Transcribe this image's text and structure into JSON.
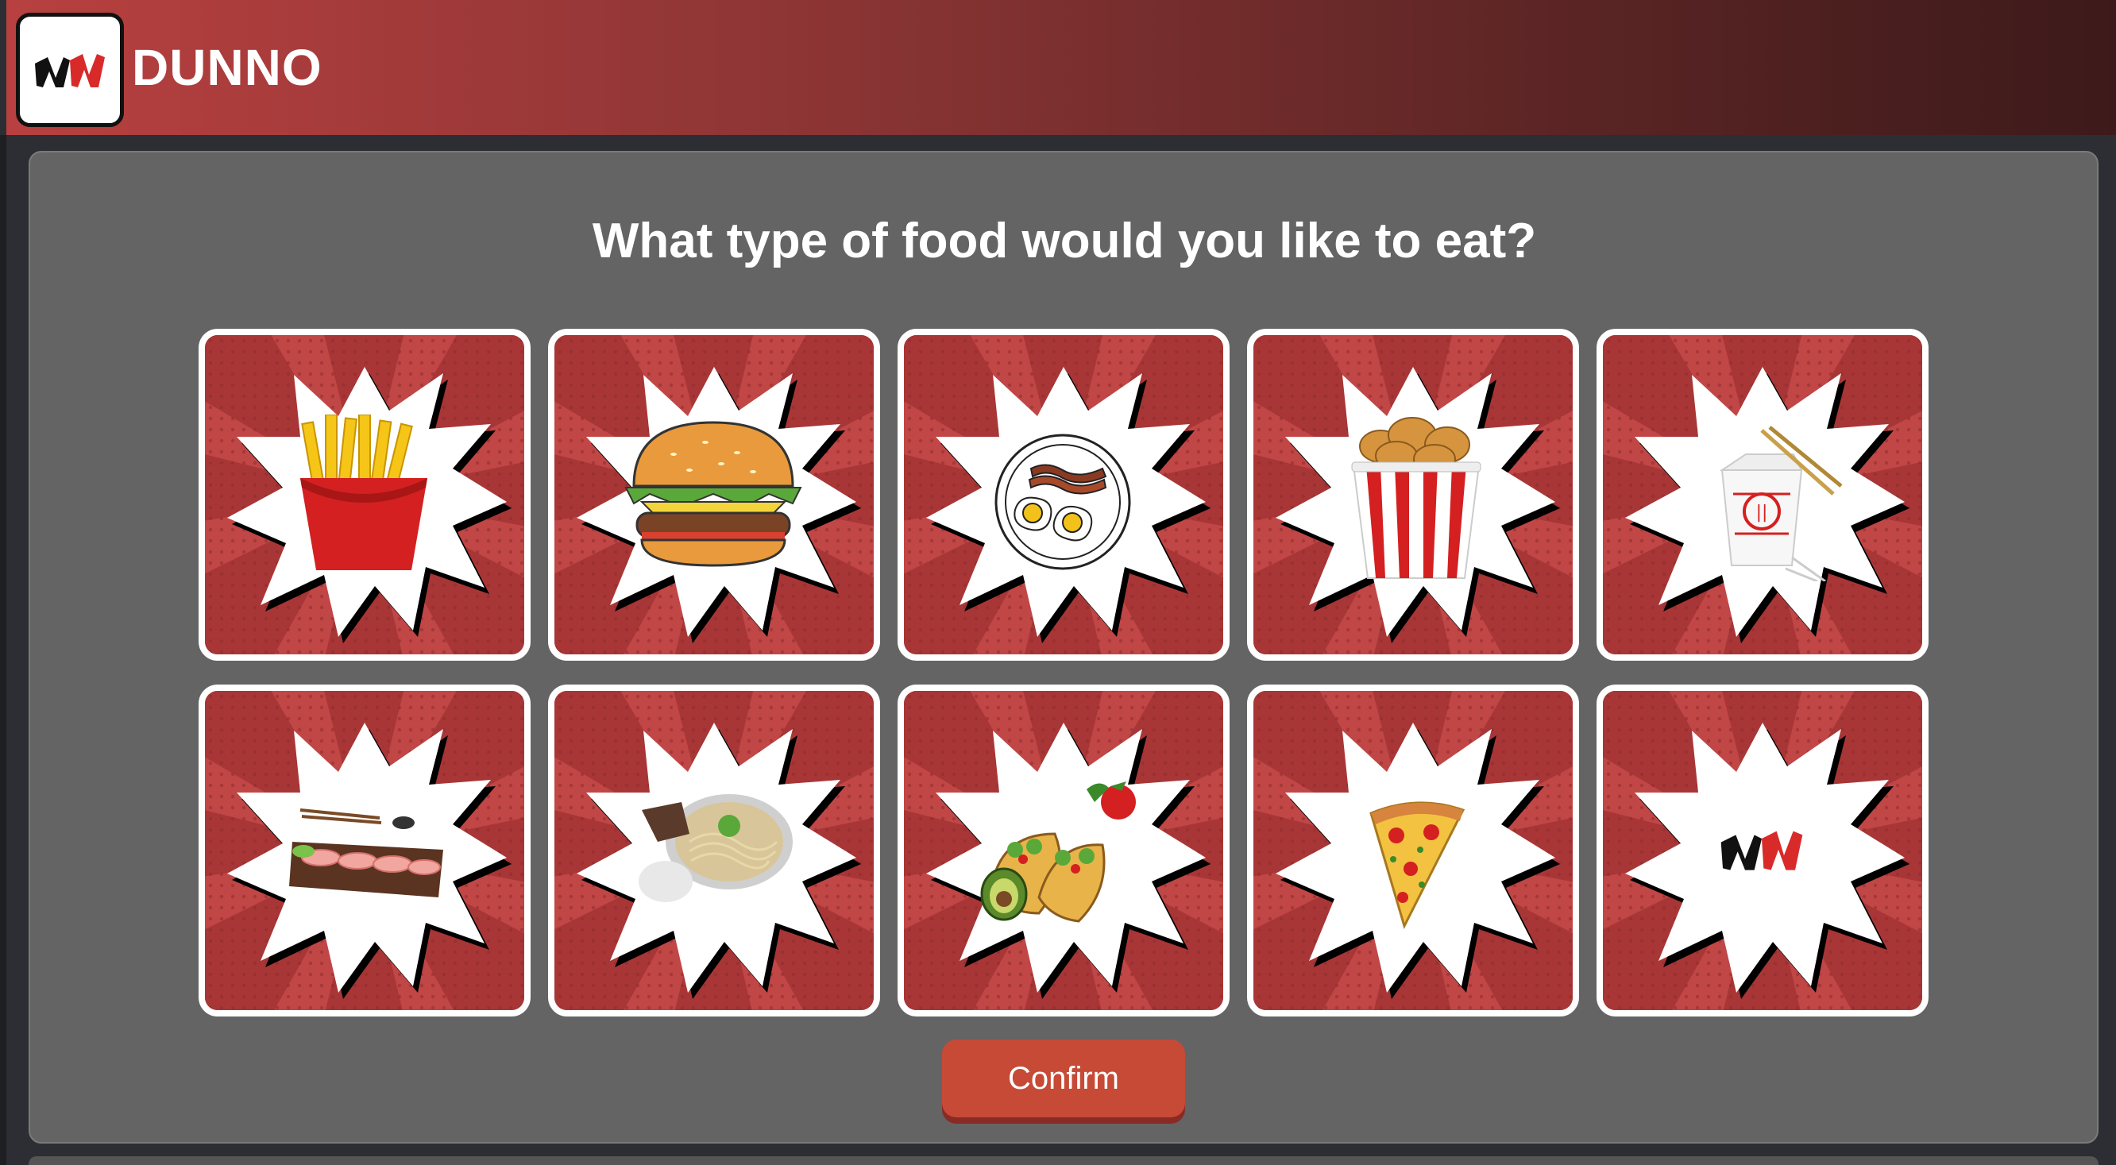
{
  "app": {
    "name": "DUNNO",
    "logo_icon": "dunno-logo-icon",
    "header_gradient": [
      "#b84040",
      "#3d1a1a"
    ]
  },
  "prompt": {
    "question": "What type of food would you like to eat?"
  },
  "options": [
    {
      "id": "fries",
      "icon": "french-fries-icon"
    },
    {
      "id": "burger",
      "icon": "burger-icon"
    },
    {
      "id": "breakfast",
      "icon": "breakfast-plate-icon"
    },
    {
      "id": "fried-chicken",
      "icon": "fried-chicken-bucket-icon"
    },
    {
      "id": "chinese",
      "icon": "chinese-takeout-icon"
    },
    {
      "id": "sushi",
      "icon": "sushi-icon"
    },
    {
      "id": "noodle-soup",
      "icon": "noodle-soup-icon"
    },
    {
      "id": "mexican",
      "icon": "tacos-icon"
    },
    {
      "id": "pizza",
      "icon": "pizza-slice-icon"
    },
    {
      "id": "dunno",
      "icon": "dunno-logo-icon"
    }
  ],
  "actions": {
    "confirm_label": "Confirm"
  },
  "colors": {
    "card_red": "#a83636",
    "card_ray": "#c14646",
    "panel": "#646464",
    "confirm": "#c64a36"
  }
}
